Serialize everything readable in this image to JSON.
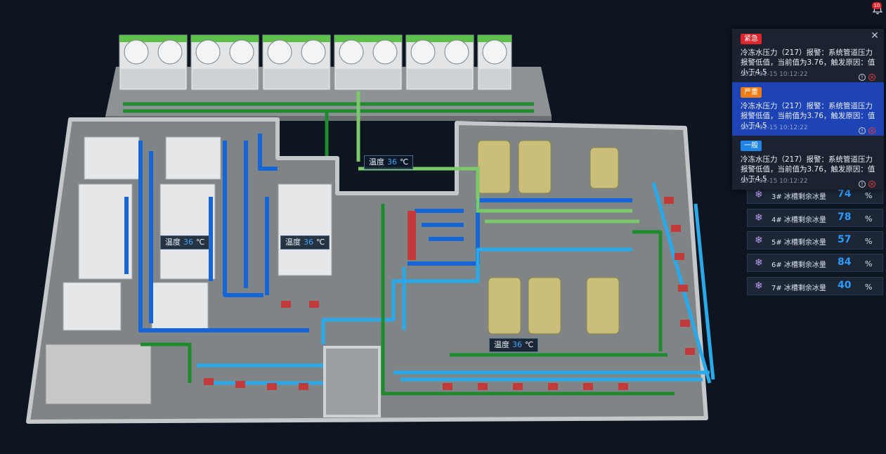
{
  "notification": {
    "badge_count": "10",
    "icon": "bell-icon"
  },
  "temperature_tags": [
    {
      "label": "温度",
      "value": "36",
      "unit": "℃"
    },
    {
      "label": "温度",
      "value": "36",
      "unit": "℃"
    },
    {
      "label": "温度",
      "value": "36",
      "unit": "℃"
    },
    {
      "label": "温度",
      "value": "36",
      "unit": "℃"
    }
  ],
  "alerts": {
    "close_icon": "close-icon",
    "items": [
      {
        "level": "紧急",
        "level_color": "#e0242b",
        "message": "冷冻水压力（217）报警：系统管道压力报警低值，当前值为3.76，触发原因：值小于4.5",
        "time": "2020-01-15  10:12:22"
      },
      {
        "level": "严重",
        "level_color": "#f07b10",
        "message": "冷冻水压力（217）报警：系统管道压力报警低值，当前值为3.76，触发原因：值小于4.5",
        "time": "2020-01-15  10:12:22"
      },
      {
        "level": "一般",
        "level_color": "#1f84e6",
        "message": "冷冻水压力（217）报警：系统管道压力报警低值，当前值为3.76，触发原因：值小于4.5",
        "time": "2020-01-15  10:12:22"
      }
    ]
  },
  "ice_tanks": [
    {
      "label": "3# 冰槽剩余冰量",
      "value": "74",
      "unit": "%"
    },
    {
      "label": "4# 冰槽剩余冰量",
      "value": "78",
      "unit": "%"
    },
    {
      "label": "5# 冰槽剩余冰量",
      "value": "57",
      "unit": "%"
    },
    {
      "label": "6# 冰槽剩余冰量",
      "value": "84",
      "unit": "%"
    },
    {
      "label": "7# 冰槽剩余冰量",
      "value": "40",
      "unit": "%"
    }
  ],
  "colors": {
    "background": "#0d1521",
    "pipe_blue": "#1565d8",
    "pipe_cyan": "#29a9ea",
    "pipe_green": "#1f8a2e",
    "pipe_light_green": "#7bc96a",
    "chiller": "#c9bf7a",
    "accent_blue": "#2b9bff"
  }
}
